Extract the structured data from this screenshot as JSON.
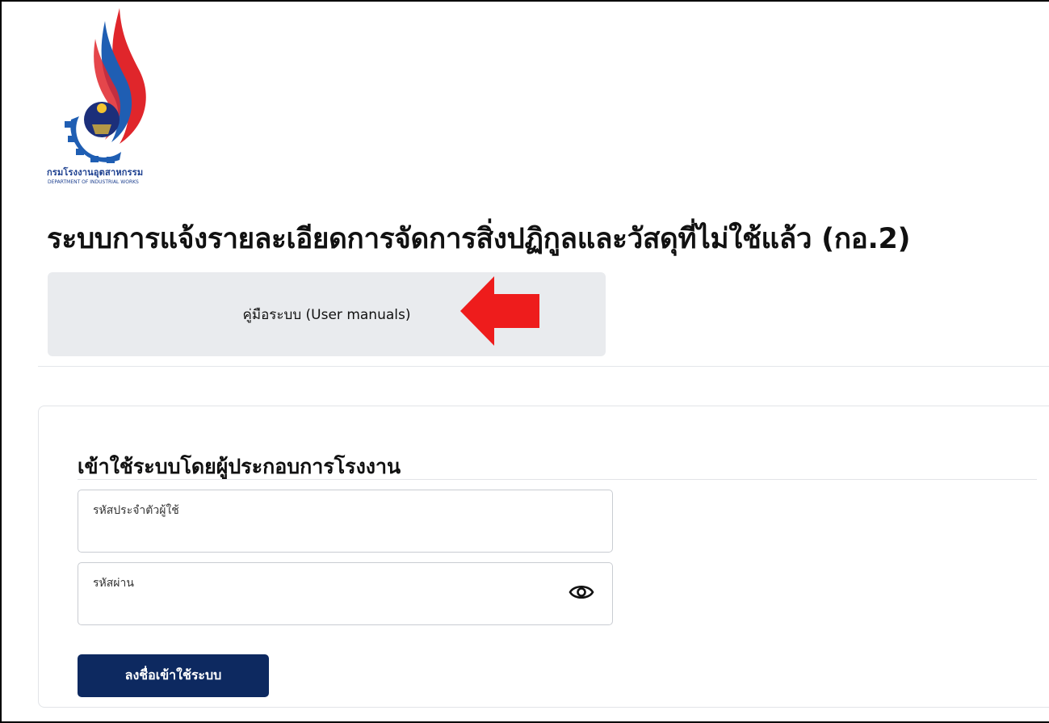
{
  "logo": {
    "name_th": "กรมโรงงานอุตสาหกรรม",
    "name_en": "DEPARTMENT OF INDUSTRIAL WORKS",
    "colors": {
      "red": "#e0262b",
      "blue": "#1f5eb3",
      "navy": "#1c3f8f"
    }
  },
  "page": {
    "title": "ระบบการแจ้งรายละเอียดการจัดการสิ่งปฏิกูลและวัสดุที่ไม่ใช้แล้ว (กอ.2)"
  },
  "manual_button": {
    "label": "คู่มือระบบ (User manuals)",
    "annotation_icon": "red-arrow-left-icon"
  },
  "login": {
    "title": "เข้าใช้ระบบโดยผู้ประกอบการโรงงาน",
    "username": {
      "label": "รหัสประจำตัวผู้ใช้",
      "value": ""
    },
    "password": {
      "label": "รหัสผ่าน",
      "value": "",
      "toggle_icon": "eye-icon"
    },
    "submit_label": "ลงชื่อเข้าใช้ระบบ"
  },
  "colors": {
    "primary_button": "#0d2960",
    "manual_bg": "#e9ebee",
    "arrow": "#ee1c1c"
  }
}
